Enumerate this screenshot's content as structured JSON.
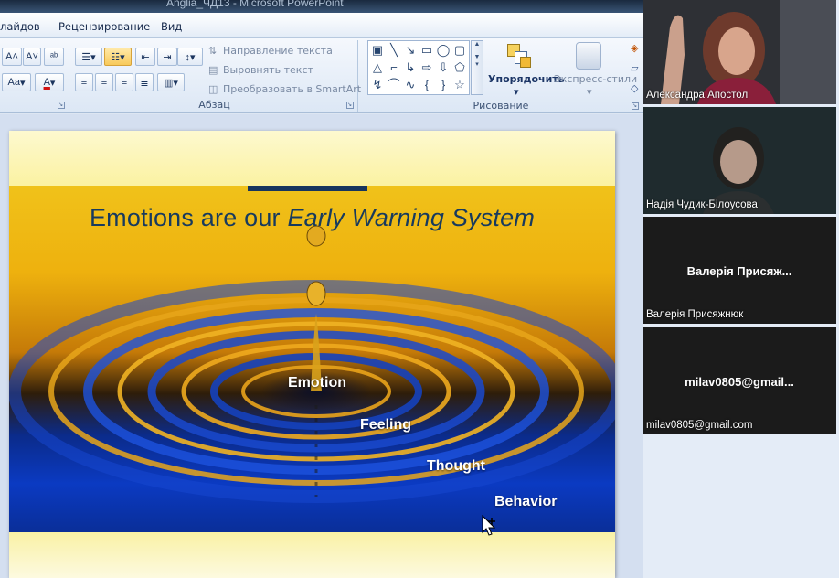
{
  "window": {
    "title": "Anglia_ЧД13 - Microsoft PowerPoint"
  },
  "ribbon_tabs": [
    "лайдов",
    "Рецензирование",
    "Вид"
  ],
  "ribbon": {
    "paragraph": {
      "text_direction": "Направление текста",
      "align_text": "Выровнять текст",
      "convert_smartart": "Преобразовать в SmartArt",
      "group_label": "Абзац"
    },
    "font_group": {
      "font_size_label": "A",
      "aa_label": "Aa",
      "font_color_label": "A"
    },
    "drawing": {
      "arrange": "Упорядочить",
      "quick_styles": "Экспресс-стили",
      "group_label": "Рисование"
    }
  },
  "slide": {
    "title_normal": "Emotions are our ",
    "title_italic": "Early Warning System",
    "words": [
      "Emotion",
      "Feeling",
      "Thought",
      "Behavior"
    ],
    "colors": {
      "title": "#173a5e",
      "accent_bar": "#17355e"
    }
  },
  "participants": [
    {
      "name": "Александра Апостол",
      "label": "",
      "video": true
    },
    {
      "name": "Надія Чудик-Білоусова",
      "label": "",
      "video": true
    },
    {
      "name": "Валерія Присяжнюк",
      "label": "Валерія Присяж...",
      "video": false
    },
    {
      "name": "milav0805@gmail.com",
      "label": "milav0805@gmail...",
      "video": false
    }
  ],
  "icons": {
    "cursor": "move-cursor-icon",
    "shapes": [
      "text-box-icon",
      "line-icon",
      "arrow-line-icon",
      "rectangle-icon",
      "oval-icon",
      "rounded-rectangle-icon",
      "triangle-icon",
      "elbow-connector-icon",
      "right-arrow-icon",
      "down-arrow-icon",
      "callout-icon",
      "curved-arrow-icon",
      "arc-icon",
      "curve-icon",
      "left-brace-icon",
      "right-brace-icon",
      "star-icon"
    ]
  }
}
